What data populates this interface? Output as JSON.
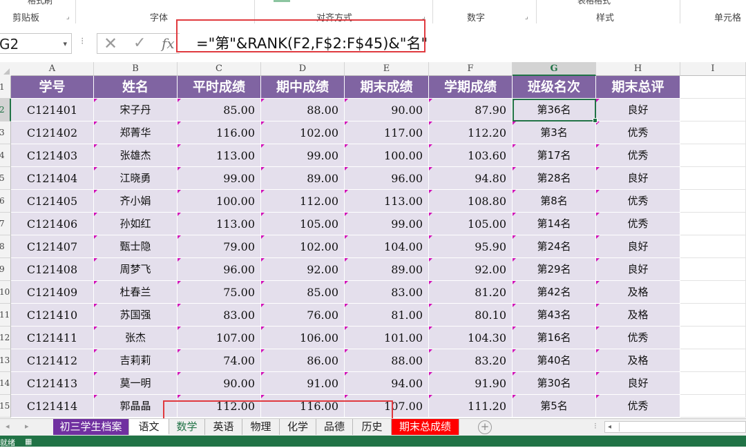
{
  "ribbon": {
    "top_fragment_1": "格式刷",
    "top_fragment_2": "表格格式",
    "groups": [
      "剪贴板",
      "字体",
      "对齐方式",
      "数字",
      "样式",
      "单元格"
    ]
  },
  "formula_bar": {
    "name_box": "G2",
    "cancel_icon": "✕",
    "enter_icon": "✓",
    "fx_label": "fx",
    "formula": "=\"第\"&RANK(F2,F$2:F$45)&\"名\""
  },
  "columns": [
    "A",
    "B",
    "C",
    "D",
    "E",
    "F",
    "G",
    "H",
    "I"
  ],
  "selected_column": "G",
  "row_numbers": [
    "1",
    "2",
    "3",
    "4",
    "5",
    "6",
    "7",
    "8",
    "9",
    "10",
    "11",
    "12",
    "13",
    "14",
    "15"
  ],
  "selected_row": "2",
  "table": {
    "headers": [
      "学号",
      "姓名",
      "平时成绩",
      "期中成绩",
      "期末成绩",
      "学期成绩",
      "班级名次",
      "期末总评"
    ],
    "rows": [
      [
        "C121401",
        "宋子丹",
        "85.00",
        "88.00",
        "90.00",
        "87.90",
        "第36名",
        "良好"
      ],
      [
        "C121402",
        "郑菁华",
        "116.00",
        "102.00",
        "117.00",
        "112.20",
        "第3名",
        "优秀"
      ],
      [
        "C121403",
        "张雄杰",
        "113.00",
        "99.00",
        "100.00",
        "103.60",
        "第17名",
        "优秀"
      ],
      [
        "C121404",
        "江晓勇",
        "99.00",
        "89.00",
        "96.00",
        "94.80",
        "第28名",
        "良好"
      ],
      [
        "C121405",
        "齐小娟",
        "100.00",
        "112.00",
        "113.00",
        "108.80",
        "第8名",
        "优秀"
      ],
      [
        "C121406",
        "孙如红",
        "113.00",
        "105.00",
        "99.00",
        "105.00",
        "第14名",
        "优秀"
      ],
      [
        "C121407",
        "甄士隐",
        "79.00",
        "102.00",
        "104.00",
        "95.90",
        "第24名",
        "良好"
      ],
      [
        "C121408",
        "周梦飞",
        "96.00",
        "92.00",
        "89.00",
        "92.00",
        "第29名",
        "良好"
      ],
      [
        "C121409",
        "杜春兰",
        "75.00",
        "85.00",
        "83.00",
        "81.20",
        "第42名",
        "及格"
      ],
      [
        "C121410",
        "苏国强",
        "83.00",
        "76.00",
        "81.00",
        "80.10",
        "第43名",
        "及格"
      ],
      [
        "C121411",
        "张杰",
        "107.00",
        "106.00",
        "101.00",
        "104.30",
        "第16名",
        "优秀"
      ],
      [
        "C121412",
        "吉莉莉",
        "74.00",
        "86.00",
        "88.00",
        "83.20",
        "第40名",
        "及格"
      ],
      [
        "C121413",
        "莫一明",
        "90.00",
        "91.00",
        "94.00",
        "91.90",
        "第30名",
        "良好"
      ],
      [
        "C121414",
        "郭晶晶",
        "112.00",
        "116.00",
        "107.00",
        "111.20",
        "第5名",
        "优秀"
      ]
    ]
  },
  "sheet_tabs": [
    "初三学生档案",
    "语文",
    "数学",
    "英语",
    "物理",
    "化学",
    "品德",
    "历史",
    "期末总成绩"
  ],
  "active_tab": "语文",
  "status_bar": {
    "text": "就绪"
  },
  "colors": {
    "header_fill": "#8064a2",
    "body_fill": "#e4dfec",
    "comment_marker": "#d10fb7",
    "highlight_box": "#e0393e",
    "excel_green": "#217346",
    "tab_purple": "#7030a0",
    "tab_red": "#ff0000"
  }
}
